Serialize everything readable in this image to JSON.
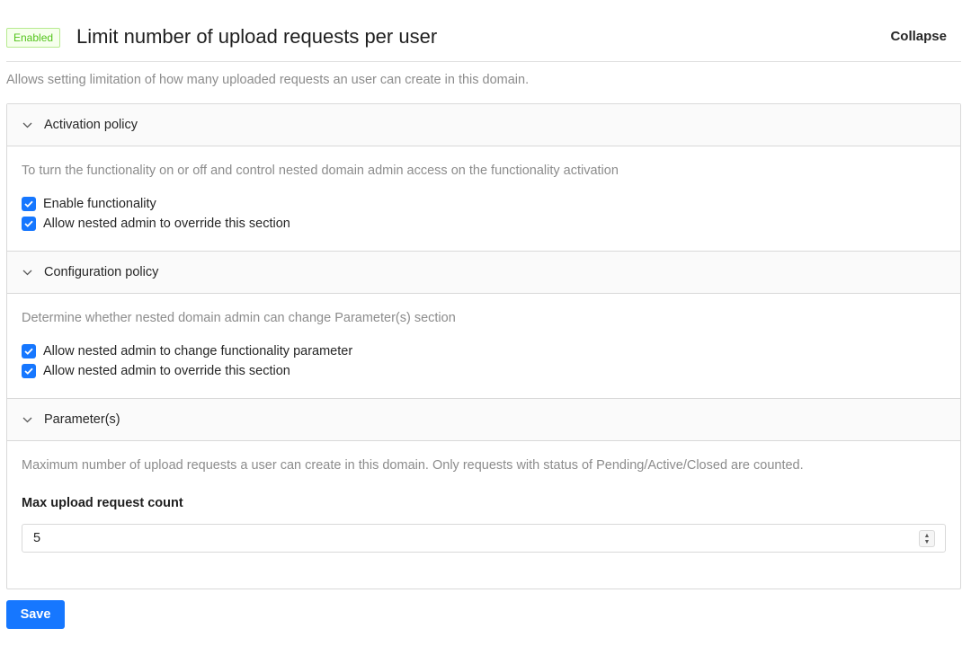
{
  "header": {
    "status_tag": "Enabled",
    "title": "Limit number of upload requests per user",
    "collapse_label": "Collapse"
  },
  "description": "Allows setting limitation of how many uploaded requests an user can create in this domain.",
  "panels": [
    {
      "title": "Activation policy",
      "description": "To turn the functionality on or off and control nested domain admin access on the functionality activation",
      "checkboxes": [
        {
          "label": "Enable functionality",
          "checked": true
        },
        {
          "label": "Allow nested admin to override this section",
          "checked": true
        }
      ]
    },
    {
      "title": "Configuration policy",
      "description": "Determine whether nested domain admin can change Parameter(s) section",
      "checkboxes": [
        {
          "label": "Allow nested admin to change functionality parameter",
          "checked": true
        },
        {
          "label": "Allow nested admin to override this section",
          "checked": true
        }
      ]
    },
    {
      "title": "Parameter(s)",
      "description": "Maximum number of upload requests a user can create in this domain. Only requests with status of Pending/Active/Closed are counted.",
      "field_label": "Max upload request count",
      "field_value": "5"
    }
  ],
  "save_label": "Save",
  "colors": {
    "primary": "#1677ff",
    "tag_green": "#52c41a",
    "muted_text": "#8c8c8c"
  },
  "icons": {
    "panel_toggle": "chevron-down-icon",
    "checkbox": "checkmark-icon",
    "spinner": "up-down-arrows-icon"
  }
}
